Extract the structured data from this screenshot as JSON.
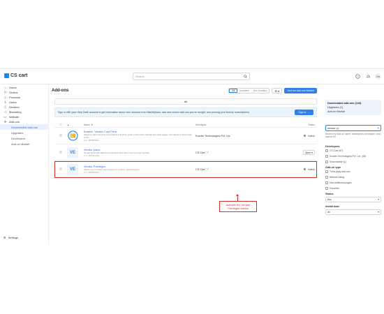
{
  "app": {
    "logo_text": "CS cart"
  },
  "topbar": {
    "search_placeholder": "Search",
    "help_icon": "?",
    "bell_icon": "bell",
    "avatar_initials": "GA"
  },
  "sidebar": {
    "items": [
      {
        "label": "Home",
        "icon": "house-icon",
        "glyph": "⌂"
      },
      {
        "label": "Orders",
        "icon": "cart-icon",
        "glyph": "⊓"
      },
      {
        "label": "Products",
        "icon": "tag-icon",
        "glyph": "◇"
      },
      {
        "label": "Users",
        "icon": "user-icon",
        "glyph": "♙"
      },
      {
        "label": "Vendors",
        "icon": "vendor-icon",
        "glyph": "♖"
      },
      {
        "label": "Marketing",
        "icon": "megaphone-icon",
        "glyph": "◁"
      },
      {
        "label": "Website",
        "icon": "monitor-icon",
        "glyph": "▭"
      },
      {
        "label": "Add-ons",
        "icon": "puzzle-icon",
        "glyph": "✣"
      }
    ],
    "subitems": [
      "Downloaded add-ons",
      "Upgrades",
      "Developers",
      "Add-on Market"
    ],
    "settings_label": "Settings"
  },
  "main": {
    "title": "Add-ons",
    "seg_all": "All",
    "seg_installed": "Installed",
    "seg_not_installed": "Not installed",
    "visit_market_label": "Visit the Add-ons Market",
    "filter_all": "All",
    "signin_text": "Sign in with your Help Desk account to get information about new versions from Marketplace, rate and review add-ons you've bought, and prolong your license subscriptions.",
    "signin_button": "Sign in",
    "columns": {
      "fav": "☆",
      "sort": "▲",
      "name": "Name ▼",
      "developer": "Developer",
      "status": "Status"
    },
    "rows": [
      {
        "logo": "",
        "name": "Ecarter: Vendor Cost Price",
        "desc": "Allows to add cost price for products and show profit on the order manage and table pages, also allows to show total profit.",
        "version": "1.0 • 28/05/2024",
        "developer": "Ecarter Technologies Pvt. Ltd.",
        "verified": false,
        "status": "Active"
      },
      {
        "logo": "VE",
        "name": "Vendor plans",
        "desc": "Create plans with different restrictions and their prices for your vendors",
        "version": "1.1 • 28/05/2024",
        "developer": "CS-Cart",
        "verified": true,
        "status": "Open",
        "button": "Open ▾"
      },
      {
        "logo": "VE",
        "name": "Vendor Privileges",
        "desc": "Allows you to create user groups for vendors' administrators.",
        "version": "1.0 • 28/05/2024",
        "developer": "CS-Cart",
        "verified": true,
        "status": "Active"
      }
    ],
    "callout": "Activate the Vendor Privileges Addon"
  },
  "rpanel": {
    "views": [
      "Downloaded add-ons (124)",
      "Upgrades (1)",
      "Add-on Market"
    ],
    "search_value": "vendor p|",
    "search_hint": "Search by add-on name, description, developer, and add-on ID",
    "developers_title": "Developers",
    "developers": [
      "CS-Cart (57)",
      "Ecarter Technologies Pvt. Ltd. (48)",
      "Searchanise (1)"
    ],
    "addon_type_title": "Add-on type",
    "addon_types": [
      "Third-party add-ons",
      "Without rating",
      "Has additional pages",
      "Favorites"
    ],
    "status_title": "Status",
    "status_value": "Any",
    "install_date_title": "Install date",
    "install_date_value": "All"
  }
}
